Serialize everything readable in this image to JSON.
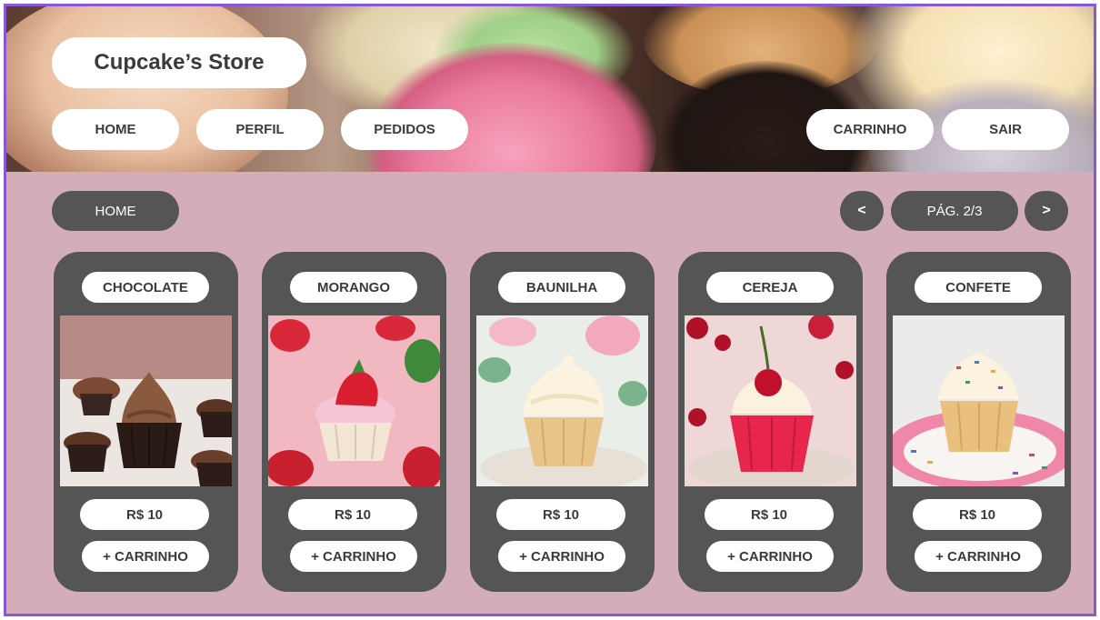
{
  "header": {
    "logo": "Cupcake’s Store",
    "nav": {
      "home": "HOME",
      "perfil": "PERFIL",
      "pedidos": "PEDIDOS",
      "carrinho": "CARRINHO",
      "sair": "SAIR"
    }
  },
  "toolbar": {
    "breadcrumb": "HOME",
    "prev": "<",
    "page": "PÁG. 2/3",
    "next": ">"
  },
  "products": [
    {
      "flavor": "CHOCOLATE",
      "price": "R$ 10",
      "add": "+ CARRINHO"
    },
    {
      "flavor": "MORANGO",
      "price": "R$ 10",
      "add": "+ CARRINHO"
    },
    {
      "flavor": "BAUNILHA",
      "price": "R$ 10",
      "add": "+ CARRINHO"
    },
    {
      "flavor": "CEREJA",
      "price": "R$ 10",
      "add": "+ CARRINHO"
    },
    {
      "flavor": "CONFETE",
      "price": "R$ 10",
      "add": "+ CARRINHO"
    }
  ],
  "colors": {
    "frame": "#8a58d6",
    "background": "#d3aeb8",
    "card": "#555555",
    "pill": "#ffffff"
  }
}
